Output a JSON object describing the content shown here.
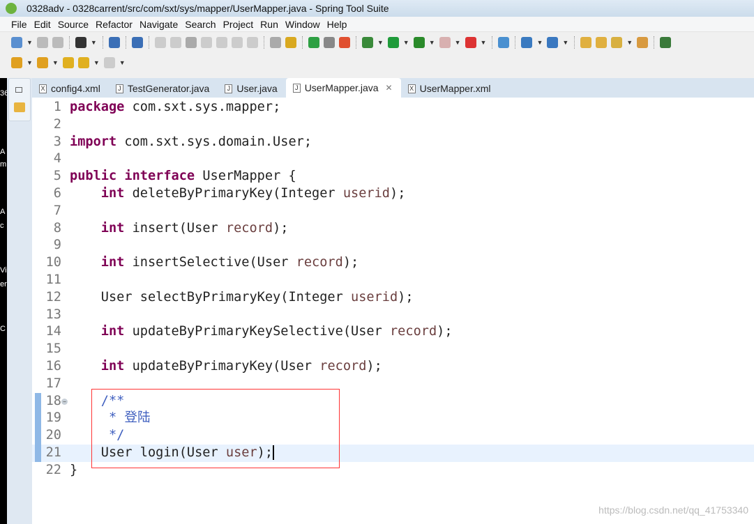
{
  "window": {
    "title": "0328adv - 0328carrent/src/com/sxt/sys/mapper/UserMapper.java - Spring Tool Suite"
  },
  "menu": [
    "File",
    "Edit",
    "Source",
    "Refactor",
    "Navigate",
    "Search",
    "Project",
    "Run",
    "Window",
    "Help"
  ],
  "toolbar1": [
    {
      "icon": "new-icon",
      "color": "#5a8fd0",
      "dd": true
    },
    {
      "icon": "save-icon",
      "color": "#bbb"
    },
    {
      "icon": "save-all-icon",
      "color": "#bbb",
      "sep": true
    },
    {
      "icon": "user-icon",
      "color": "#333",
      "dd": true,
      "sep": true
    },
    {
      "icon": "console-icon",
      "color": "#3b6fb6",
      "sep": true
    },
    {
      "icon": "skip-breakpoints-icon",
      "color": "#3b6fb6",
      "sep": true
    },
    {
      "icon": "resume-icon",
      "color": "#ccc"
    },
    {
      "icon": "suspend-icon",
      "color": "#ccc"
    },
    {
      "icon": "terminate-icon",
      "color": "#aaa"
    },
    {
      "icon": "disconnect-icon",
      "color": "#ccc"
    },
    {
      "icon": "step-into-icon",
      "color": "#ccc"
    },
    {
      "icon": "step-over-icon",
      "color": "#ccc"
    },
    {
      "icon": "step-return-icon",
      "color": "#ccc",
      "sep": true
    },
    {
      "icon": "drop-frame-icon",
      "color": "#aaa"
    },
    {
      "icon": "use-step-filters-icon",
      "color": "#d9a920",
      "sep": true
    },
    {
      "icon": "spring-boot-icon",
      "color": "#2ea043"
    },
    {
      "icon": "toggle-view-icon",
      "color": "#888"
    },
    {
      "icon": "refresh-icon",
      "color": "#e05030",
      "sep": true
    },
    {
      "icon": "debug-icon",
      "color": "#3a8a3a",
      "dd": true
    },
    {
      "icon": "run-icon",
      "color": "#1f9b3a",
      "dd": true
    },
    {
      "icon": "run-coverage-icon",
      "color": "#2a8a2a",
      "dd": true
    },
    {
      "icon": "stop-icon",
      "color": "#d8b0b0",
      "dd": true
    },
    {
      "icon": "external-tools-icon",
      "color": "#d33",
      "dd": true,
      "sep": true
    },
    {
      "icon": "open-type-icon",
      "color": "#4a90d0",
      "sep": true
    },
    {
      "icon": "new-server-icon",
      "color": "#3a7ac0",
      "dd": true
    },
    {
      "icon": "spring-icon",
      "color": "#3a78c0",
      "dd": true,
      "sep": true
    },
    {
      "icon": "open-folder-icon",
      "color": "#e0b040"
    },
    {
      "icon": "folder-icon",
      "color": "#e0b040"
    },
    {
      "icon": "pen-icon",
      "color": "#d8b040",
      "dd": true
    },
    {
      "icon": "package-icon",
      "color": "#d89a40",
      "sep": true
    },
    {
      "icon": "pin-icon",
      "color": "#3a7a3a"
    }
  ],
  "toolbar2": [
    {
      "icon": "next-annotation-icon",
      "color": "#e0a020",
      "dd": true
    },
    {
      "icon": "previous-annotation-icon",
      "color": "#e0a020",
      "dd": true
    },
    {
      "icon": "last-edit-location-icon",
      "color": "#e0b020"
    },
    {
      "icon": "back-icon",
      "color": "#e0b020",
      "dd": true
    },
    {
      "icon": "forward-icon",
      "color": "#ccc",
      "dd": true
    }
  ],
  "left_strip": [
    "36",
    "A",
    "m",
    "A",
    "c",
    "Vi",
    "er",
    "C"
  ],
  "tabs": [
    {
      "label": "config4.xml",
      "icon": "X"
    },
    {
      "label": "TestGenerator.java",
      "icon": "J"
    },
    {
      "label": "User.java",
      "icon": "J"
    },
    {
      "label": "UserMapper.java",
      "icon": "J",
      "active": true,
      "close": "✕"
    },
    {
      "label": "UserMapper.xml",
      "icon": "X"
    }
  ],
  "code": [
    [
      [
        "kw",
        "package"
      ],
      [
        "t",
        " com.sxt.sys.mapper;"
      ]
    ],
    [],
    [
      [
        "kw",
        "import"
      ],
      [
        "t",
        " com.sxt.sys.domain.User;"
      ]
    ],
    [],
    [
      [
        "kw",
        "public"
      ],
      [
        "t",
        " "
      ],
      [
        "kw",
        "interface"
      ],
      [
        "t",
        " UserMapper {"
      ]
    ],
    [
      [
        "t",
        "    "
      ],
      [
        "kw",
        "int"
      ],
      [
        "t",
        " deleteByPrimaryKey(Integer "
      ],
      [
        "par",
        "userid"
      ],
      [
        "t",
        ");"
      ]
    ],
    [],
    [
      [
        "t",
        "    "
      ],
      [
        "kw",
        "int"
      ],
      [
        "t",
        " insert(User "
      ],
      [
        "par",
        "record"
      ],
      [
        "t",
        ");"
      ]
    ],
    [],
    [
      [
        "t",
        "    "
      ],
      [
        "kw",
        "int"
      ],
      [
        "t",
        " insertSelective(User "
      ],
      [
        "par",
        "record"
      ],
      [
        "t",
        ");"
      ]
    ],
    [],
    [
      [
        "t",
        "    User selectByPrimaryKey(Integer "
      ],
      [
        "par",
        "userid"
      ],
      [
        "t",
        ");"
      ]
    ],
    [],
    [
      [
        "t",
        "    "
      ],
      [
        "kw",
        "int"
      ],
      [
        "t",
        " updateByPrimaryKeySelective(User "
      ],
      [
        "par",
        "record"
      ],
      [
        "t",
        ");"
      ]
    ],
    [],
    [
      [
        "t",
        "    "
      ],
      [
        "kw",
        "int"
      ],
      [
        "t",
        " updateByPrimaryKey(User "
      ],
      [
        "par",
        "record"
      ],
      [
        "t",
        ");"
      ]
    ],
    [],
    [
      [
        "cm",
        "    /**"
      ]
    ],
    [
      [
        "cm",
        "     * 登陆"
      ]
    ],
    [
      [
        "cm",
        "     */"
      ]
    ],
    [
      [
        "t",
        "    User login(User "
      ],
      [
        "par",
        "user"
      ],
      [
        "t",
        ");"
      ]
    ],
    [
      [
        "t",
        "}"
      ]
    ]
  ],
  "editor": {
    "current_line": 21,
    "fold_line": 18,
    "changed_lines": [
      18,
      19,
      20,
      21
    ]
  },
  "watermark": "https://blog.csdn.net/qq_41753340"
}
